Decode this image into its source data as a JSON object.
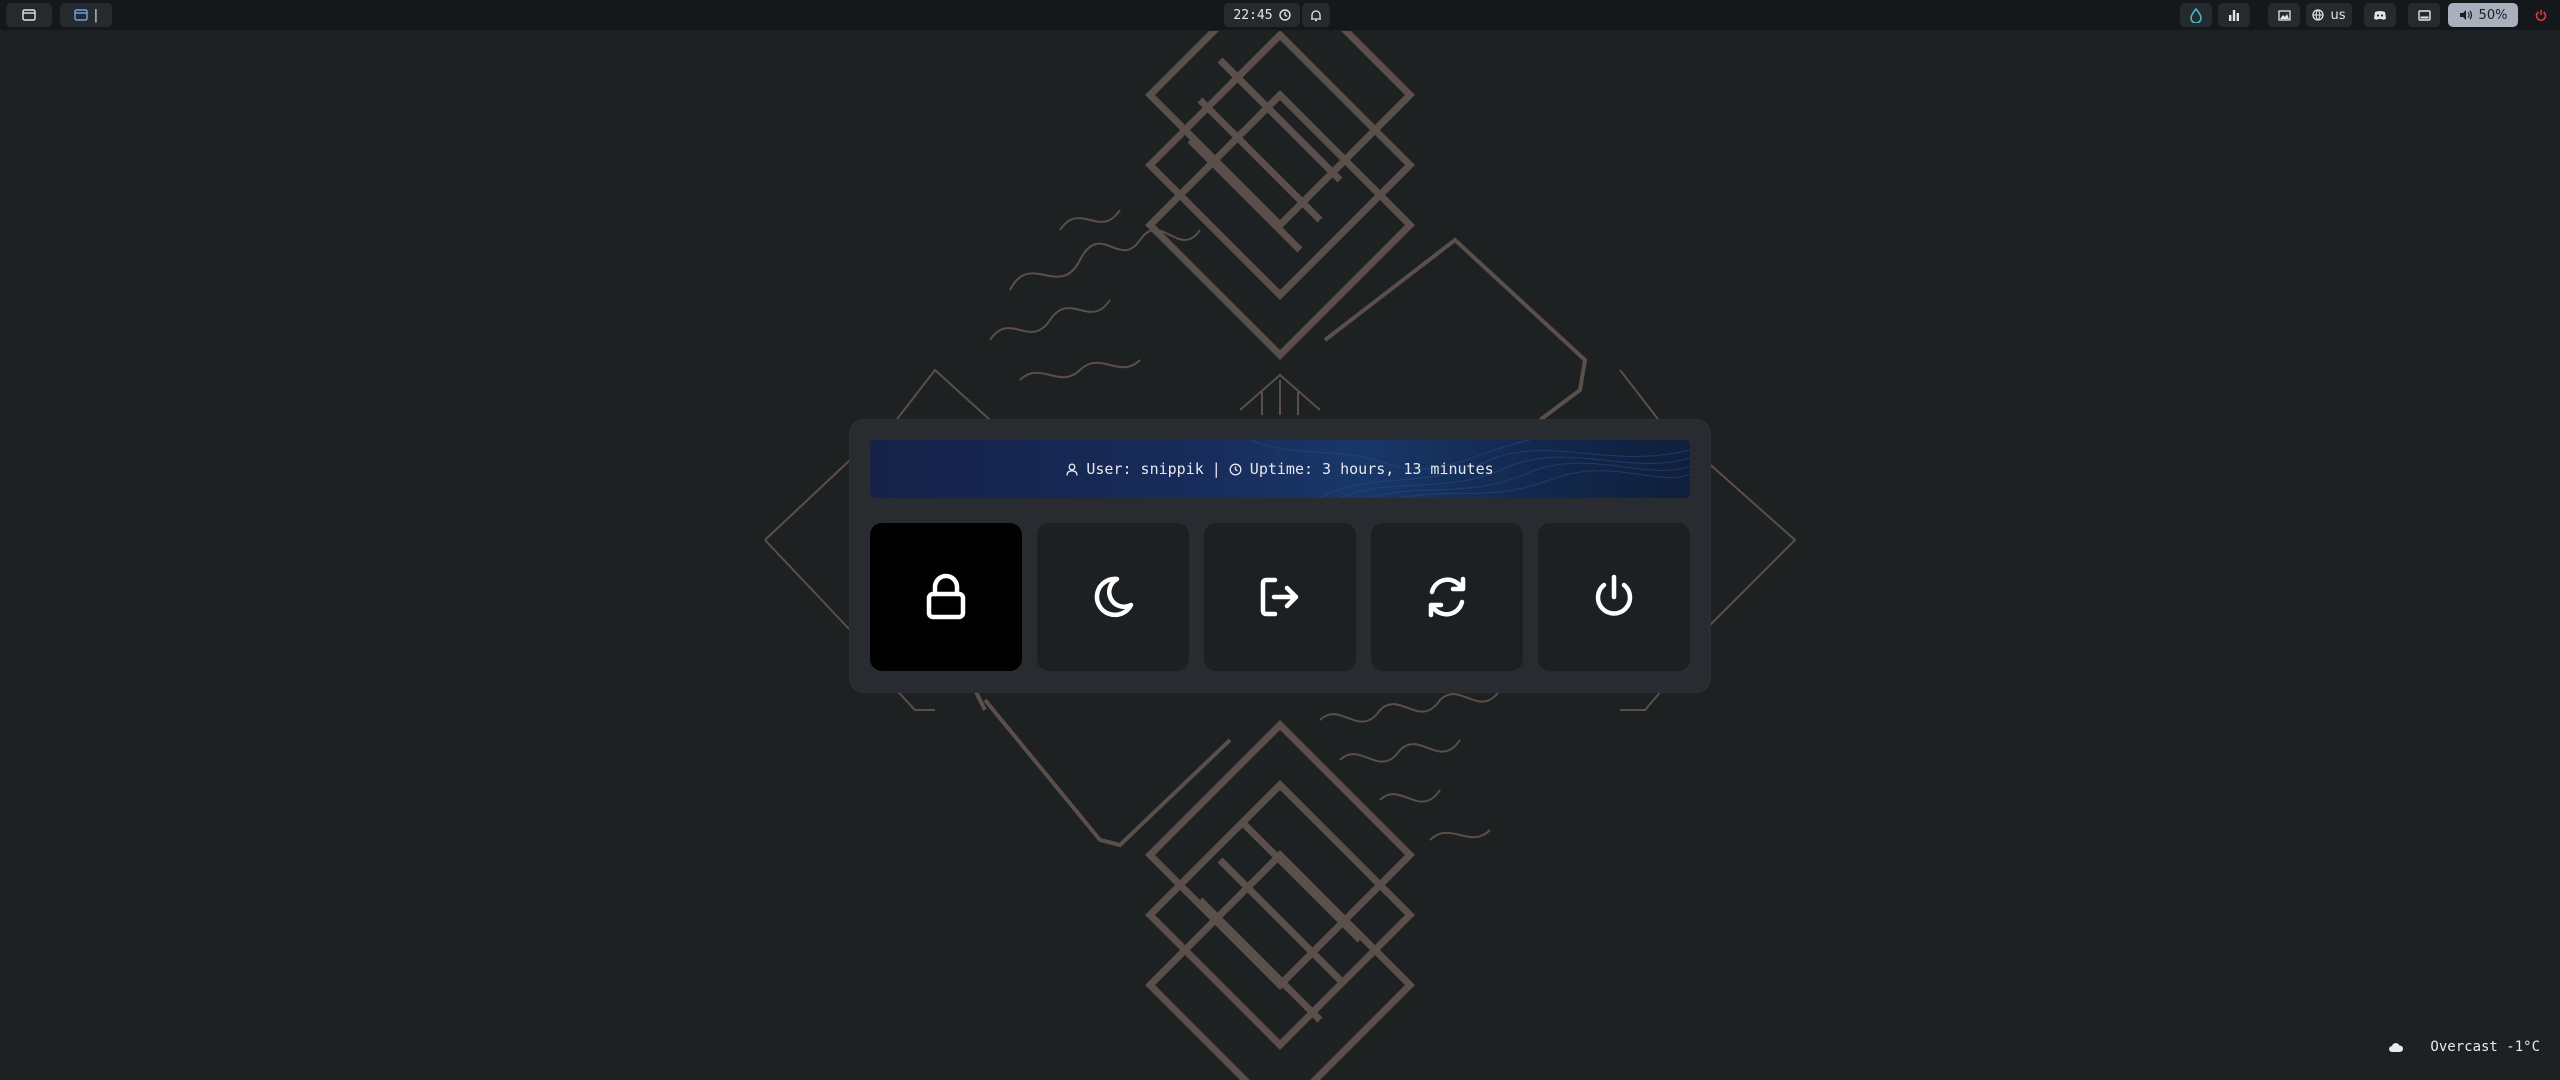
{
  "topbar": {
    "left": [
      {
        "icon": "window-icon"
      },
      {
        "icon": "app-window-icon",
        "label": "|"
      }
    ],
    "clock": {
      "time": "22:45",
      "icon": "clock-icon",
      "notify_icon": "bell-icon"
    },
    "right": [
      {
        "icon": "droplet-icon",
        "color": "#3fc1c9"
      },
      {
        "icon": "bar-chart-icon"
      },
      {
        "icon": "image-icon"
      },
      {
        "icon": "globe-icon",
        "label": "us"
      },
      {
        "icon": "discord-icon"
      },
      {
        "icon": "monitor-icon"
      },
      {
        "icon": "volume-icon",
        "label": "50%"
      },
      {
        "icon": "power-icon",
        "color": "#e0393e"
      }
    ]
  },
  "session": {
    "user_icon": "user-icon",
    "user_text": "User: snippik",
    "separator": "|",
    "uptime_icon": "clock-icon",
    "uptime_text": "Uptime: 3 hours, 13 minutes",
    "actions": [
      {
        "name": "lock",
        "icon": "lock-icon",
        "selected": true
      },
      {
        "name": "suspend",
        "icon": "moon-icon",
        "selected": false
      },
      {
        "name": "logout",
        "icon": "logout-icon",
        "selected": false
      },
      {
        "name": "reboot",
        "icon": "refresh-icon",
        "selected": false
      },
      {
        "name": "shutdown",
        "icon": "power-icon",
        "selected": false
      }
    ]
  },
  "weather": {
    "icon": "cloud-icon",
    "text": "Overcast -1°C"
  },
  "colors": {
    "background": "#1e2121",
    "panel": "#282b2f",
    "button": "#1d2023",
    "selected_button": "#000000",
    "wallpaper_art": "#5a4f4a",
    "accent": "#3fc1c9",
    "power_red": "#e0393e"
  }
}
